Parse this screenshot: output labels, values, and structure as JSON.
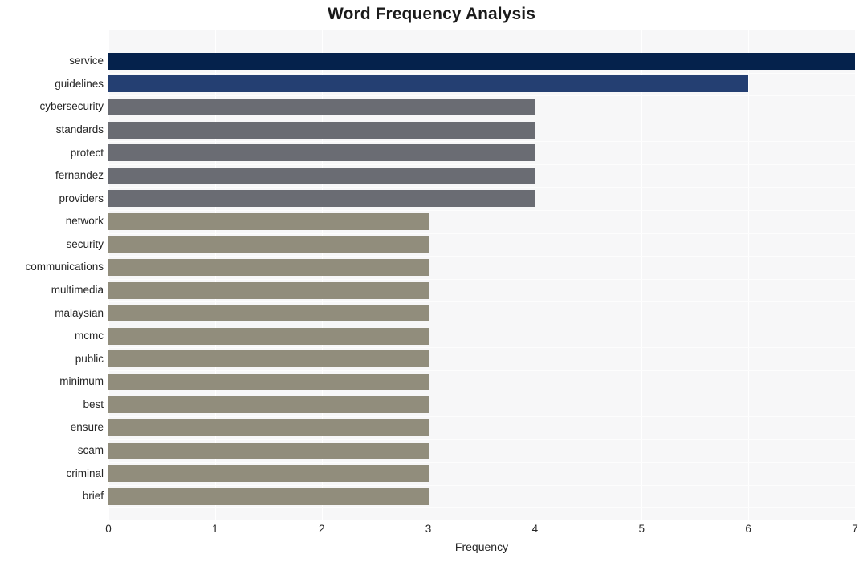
{
  "chart_data": {
    "type": "bar",
    "orientation": "horizontal",
    "title": "Word Frequency Analysis",
    "xlabel": "Frequency",
    "ylabel": "",
    "xlim": [
      0,
      7
    ],
    "xticks": [
      0,
      1,
      2,
      3,
      4,
      5,
      6,
      7
    ],
    "xtick_labels": [
      "0",
      "1",
      "2",
      "3",
      "4",
      "5",
      "6",
      "7"
    ],
    "grid": true,
    "grid_color": "#ffffff",
    "plot_background": "#f7f7f8",
    "figure_background": "#ffffff",
    "legend": null,
    "categories": [
      "service",
      "guidelines",
      "cybersecurity",
      "standards",
      "protect",
      "fernandez",
      "providers",
      "network",
      "security",
      "communications",
      "multimedia",
      "malaysian",
      "mcmc",
      "public",
      "minimum",
      "best",
      "ensure",
      "scam",
      "criminal",
      "brief"
    ],
    "values": [
      7,
      6,
      4,
      4,
      4,
      4,
      4,
      3,
      3,
      3,
      3,
      3,
      3,
      3,
      3,
      3,
      3,
      3,
      3,
      3
    ],
    "bar_colors": [
      "#05224c",
      "#243f72",
      "#6a6c73",
      "#6a6c73",
      "#6a6c73",
      "#6a6c73",
      "#6a6c73",
      "#918d7c",
      "#918d7c",
      "#918d7c",
      "#918d7c",
      "#918d7c",
      "#918d7c",
      "#918d7c",
      "#918d7c",
      "#918d7c",
      "#918d7c",
      "#918d7c",
      "#918d7c",
      "#918d7c"
    ]
  }
}
